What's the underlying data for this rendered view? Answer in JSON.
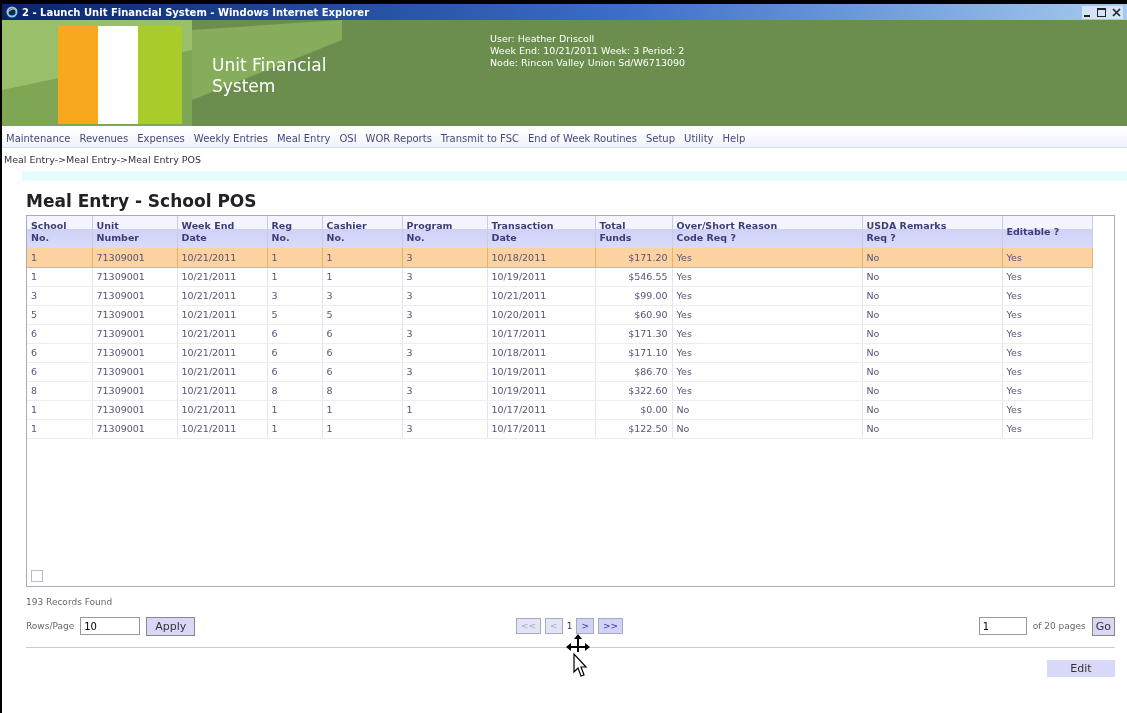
{
  "window": {
    "title": "2 - Launch Unit Financial System - Windows Internet Explorer"
  },
  "header": {
    "app_name_line1": "Unit Financial",
    "app_name_line2": "System",
    "user": "User: Heather Driscoll",
    "week": "Week End: 10/21/2011 Week: 3 Period: 2",
    "node": "Node: Rincon Valley Union Sd/W6713090"
  },
  "menu": [
    "Maintenance",
    "Revenues",
    "Expenses",
    "Weekly Entries",
    "Meal Entry",
    "OSI",
    "WOR Reports",
    "Transmit to FSC",
    "End of Week Routines",
    "Setup",
    "Utility",
    "Help"
  ],
  "breadcrumb": "Meal Entry->Meal Entry->Meal Entry POS",
  "page_title": "Meal Entry - School POS",
  "table": {
    "columns": [
      "School No.",
      "Unit Number",
      "Week End Date",
      "Reg No.",
      "Cashier No.",
      "Program No.",
      "Transaction Date",
      "Total Funds",
      "Over/Short Reason Code Req ?",
      "USDA Remarks Req ?",
      "Editable ?"
    ],
    "rows": [
      {
        "selected": true,
        "cells": [
          "1",
          "71309001",
          "10/21/2011",
          "1",
          "1",
          "3",
          "10/18/2011",
          "$171.20",
          "Yes",
          "No",
          "Yes"
        ]
      },
      {
        "selected": false,
        "cells": [
          "1",
          "71309001",
          "10/21/2011",
          "1",
          "1",
          "3",
          "10/19/2011",
          "$546.55",
          "Yes",
          "No",
          "Yes"
        ]
      },
      {
        "selected": false,
        "cells": [
          "3",
          "71309001",
          "10/21/2011",
          "3",
          "3",
          "3",
          "10/21/2011",
          "$99.00",
          "Yes",
          "No",
          "Yes"
        ]
      },
      {
        "selected": false,
        "cells": [
          "5",
          "71309001",
          "10/21/2011",
          "5",
          "5",
          "3",
          "10/20/2011",
          "$60.90",
          "Yes",
          "No",
          "Yes"
        ]
      },
      {
        "selected": false,
        "cells": [
          "6",
          "71309001",
          "10/21/2011",
          "6",
          "6",
          "3",
          "10/17/2011",
          "$171.30",
          "Yes",
          "No",
          "Yes"
        ]
      },
      {
        "selected": false,
        "cells": [
          "6",
          "71309001",
          "10/21/2011",
          "6",
          "6",
          "3",
          "10/18/2011",
          "$171.10",
          "Yes",
          "No",
          "Yes"
        ]
      },
      {
        "selected": false,
        "cells": [
          "6",
          "71309001",
          "10/21/2011",
          "6",
          "6",
          "3",
          "10/19/2011",
          "$86.70",
          "Yes",
          "No",
          "Yes"
        ]
      },
      {
        "selected": false,
        "cells": [
          "8",
          "71309001",
          "10/21/2011",
          "8",
          "8",
          "3",
          "10/19/2011",
          "$322.60",
          "Yes",
          "No",
          "Yes"
        ]
      },
      {
        "selected": false,
        "cells": [
          "1",
          "71309001",
          "10/21/2011",
          "1",
          "1",
          "1",
          "10/17/2011",
          "$0.00",
          "No",
          "No",
          "Yes"
        ]
      },
      {
        "selected": false,
        "cells": [
          "1",
          "71309001",
          "10/21/2011",
          "1",
          "1",
          "3",
          "10/17/2011",
          "$122.50",
          "No",
          "No",
          "Yes"
        ]
      }
    ]
  },
  "records_found": "193 Records Found",
  "rows_per_page": {
    "label": "Rows/Page",
    "value": "10",
    "button": "Apply"
  },
  "pager": [
    {
      "label": "<<",
      "disabled": true
    },
    {
      "label": "<",
      "disabled": true
    },
    {
      "label": "1",
      "kind": "page"
    },
    {
      "label": ">",
      "disabled": false
    },
    {
      "label": ">>",
      "disabled": false
    }
  ],
  "goto": {
    "value": "1",
    "suffix": "of 20 pages",
    "button": "Go"
  },
  "edit_button": "Edit"
}
